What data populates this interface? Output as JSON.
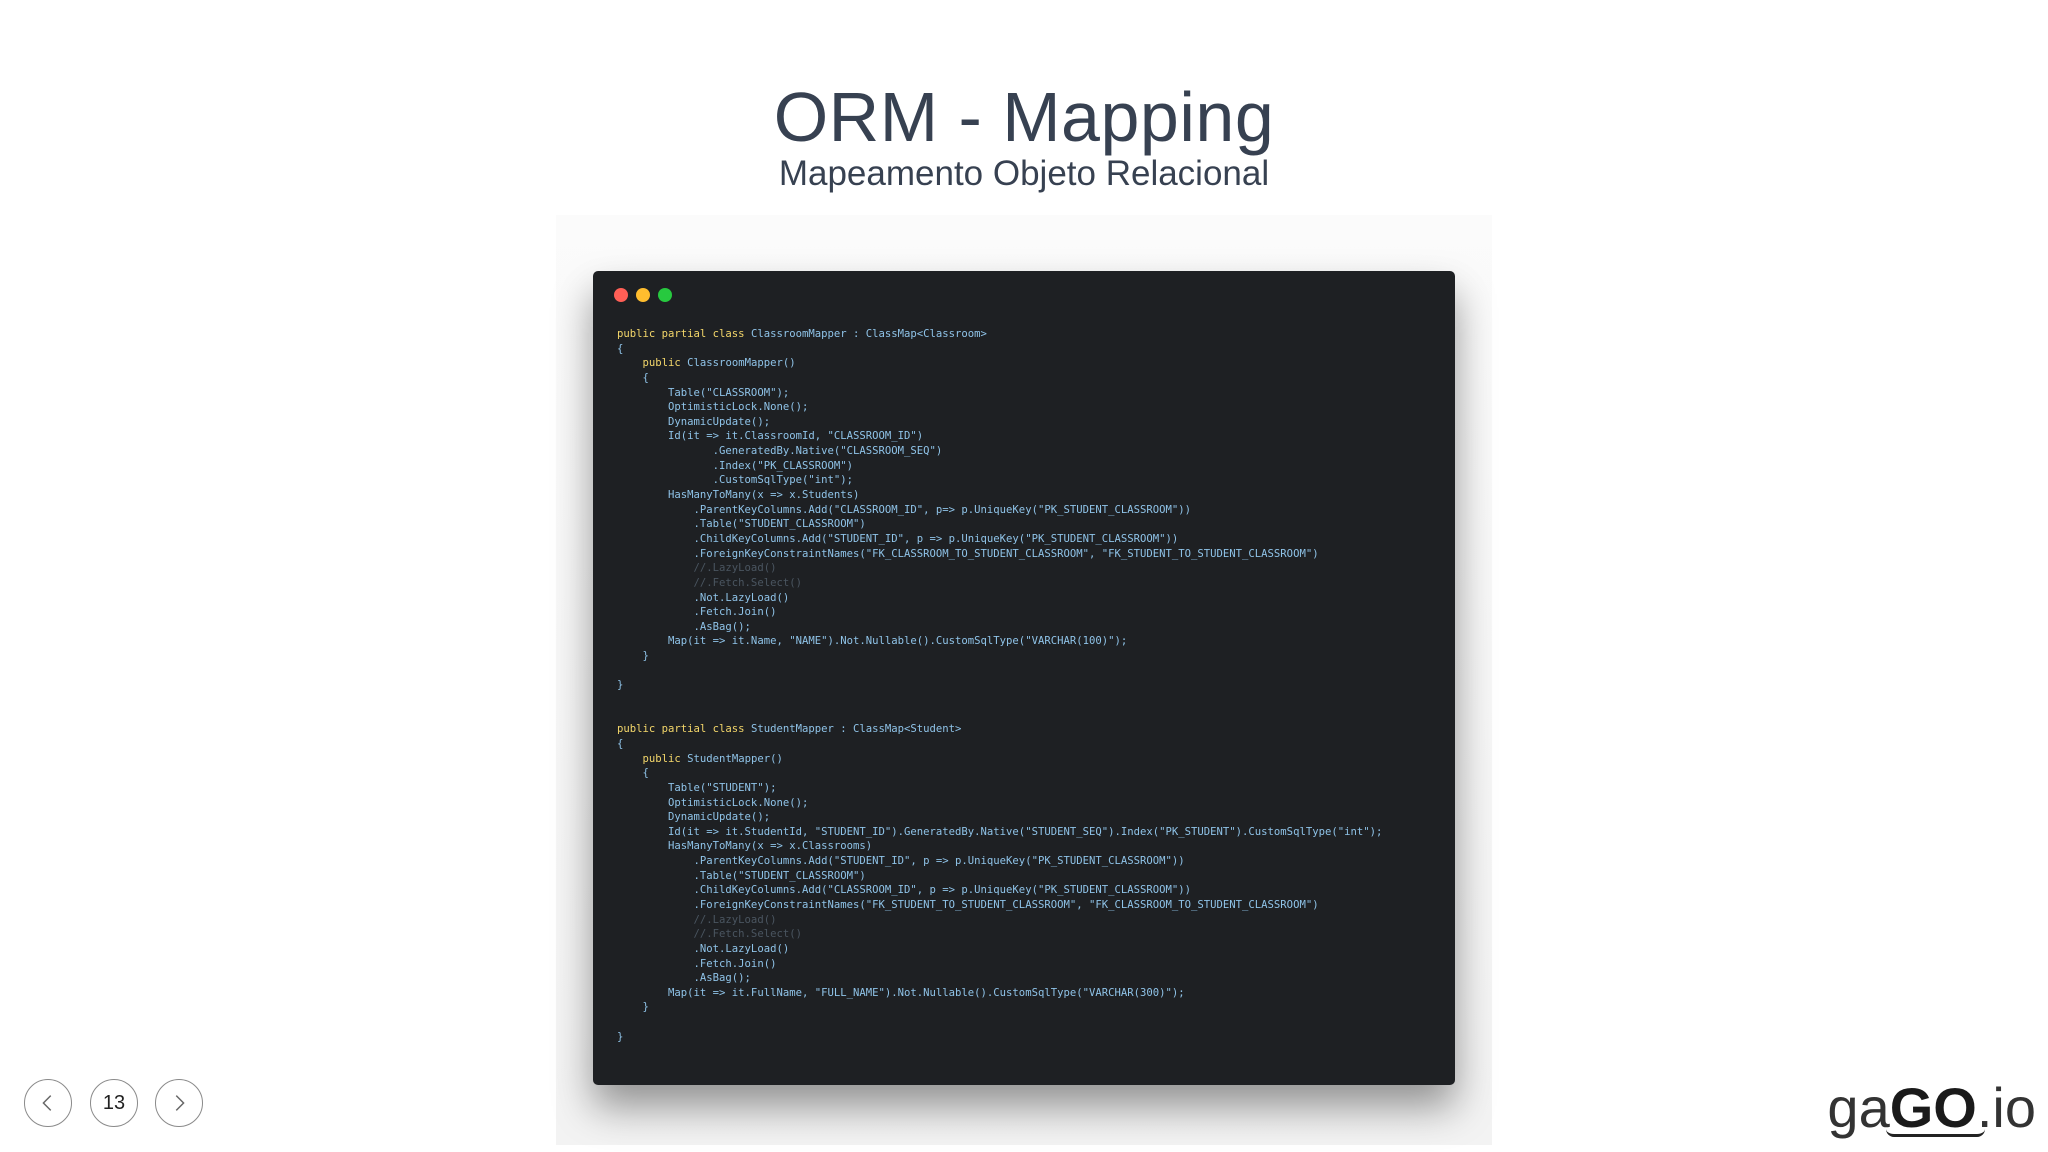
{
  "slide": {
    "title": "ORM - Mapping",
    "subtitle": "Mapeamento Objeto Relacional",
    "page_number": "13"
  },
  "window": {
    "dots": [
      {
        "name": "close",
        "color": "#ff5f56"
      },
      {
        "name": "minimize",
        "color": "#ffbd2e"
      },
      {
        "name": "maximize",
        "color": "#27c93f"
      }
    ]
  },
  "code": {
    "lines": [
      [
        {
          "t": "public partial class ",
          "c": "kw"
        },
        {
          "t": "ClassroomMapper : ClassMap<Classroom>"
        }
      ],
      [
        {
          "t": "{"
        }
      ],
      [
        {
          "t": "    "
        },
        {
          "t": "public ",
          "c": "kw"
        },
        {
          "t": "ClassroomMapper()"
        }
      ],
      [
        {
          "t": "    {"
        }
      ],
      [
        {
          "t": "        Table(\"CLASSROOM\");"
        }
      ],
      [
        {
          "t": "        OptimisticLock.None();"
        }
      ],
      [
        {
          "t": "        DynamicUpdate();"
        }
      ],
      [
        {
          "t": "        Id(it => it.ClassroomId, \"CLASSROOM_ID\")"
        }
      ],
      [
        {
          "t": "               .GeneratedBy.Native(\"CLASSROOM_SEQ\")"
        }
      ],
      [
        {
          "t": "               .Index(\"PK_CLASSROOM\")"
        }
      ],
      [
        {
          "t": "               .CustomSqlType(\"int\");"
        }
      ],
      [
        {
          "t": "        HasManyToMany(x => x.Students)"
        }
      ],
      [
        {
          "t": "            .ParentKeyColumns.Add(\"CLASSROOM_ID\", p=> p.UniqueKey(\"PK_STUDENT_CLASSROOM\"))"
        }
      ],
      [
        {
          "t": "            .Table(\"STUDENT_CLASSROOM\")"
        }
      ],
      [
        {
          "t": "            .ChildKeyColumns.Add(\"STUDENT_ID\", p => p.UniqueKey(\"PK_STUDENT_CLASSROOM\"))"
        }
      ],
      [
        {
          "t": "            .ForeignKeyConstraintNames(\"FK_CLASSROOM_TO_STUDENT_CLASSROOM\", \"FK_STUDENT_TO_STUDENT_CLASSROOM\")"
        }
      ],
      [
        {
          "t": "            //.LazyLoad()",
          "c": "cm"
        }
      ],
      [
        {
          "t": "            //.Fetch.Select()",
          "c": "cm"
        }
      ],
      [
        {
          "t": "            .Not.LazyLoad()"
        }
      ],
      [
        {
          "t": "            .Fetch.Join()"
        }
      ],
      [
        {
          "t": "            .AsBag();"
        }
      ],
      [
        {
          "t": "        Map(it => it.Name, \"NAME\").Not.Nullable().CustomSqlType(\"VARCHAR(100)\");"
        }
      ],
      [
        {
          "t": "    }"
        }
      ],
      [
        {
          "t": ""
        }
      ],
      [
        {
          "t": "}"
        }
      ],
      [
        {
          "t": ""
        }
      ],
      [
        {
          "t": ""
        }
      ],
      [
        {
          "t": "public partial class ",
          "c": "kw"
        },
        {
          "t": "StudentMapper : ClassMap<Student>"
        }
      ],
      [
        {
          "t": "{"
        }
      ],
      [
        {
          "t": "    "
        },
        {
          "t": "public ",
          "c": "kw"
        },
        {
          "t": "StudentMapper()"
        }
      ],
      [
        {
          "t": "    {"
        }
      ],
      [
        {
          "t": "        Table(\"STUDENT\");"
        }
      ],
      [
        {
          "t": "        OptimisticLock.None();"
        }
      ],
      [
        {
          "t": "        DynamicUpdate();"
        }
      ],
      [
        {
          "t": "        Id(it => it.StudentId, \"STUDENT_ID\").GeneratedBy.Native(\"STUDENT_SEQ\").Index(\"PK_STUDENT\").CustomSqlType(\"int\");"
        }
      ],
      [
        {
          "t": "        HasManyToMany(x => x.Classrooms)"
        }
      ],
      [
        {
          "t": "            .ParentKeyColumns.Add(\"STUDENT_ID\", p => p.UniqueKey(\"PK_STUDENT_CLASSROOM\"))"
        }
      ],
      [
        {
          "t": "            .Table(\"STUDENT_CLASSROOM\")"
        }
      ],
      [
        {
          "t": "            .ChildKeyColumns.Add(\"CLASSROOM_ID\", p => p.UniqueKey(\"PK_STUDENT_CLASSROOM\"))"
        }
      ],
      [
        {
          "t": "            .ForeignKeyConstraintNames(\"FK_STUDENT_TO_STUDENT_CLASSROOM\", \"FK_CLASSROOM_TO_STUDENT_CLASSROOM\")"
        }
      ],
      [
        {
          "t": "            //.LazyLoad()",
          "c": "cm"
        }
      ],
      [
        {
          "t": "            //.Fetch.Select()",
          "c": "cm"
        }
      ],
      [
        {
          "t": "            .Not.LazyLoad()"
        }
      ],
      [
        {
          "t": "            .Fetch.Join()"
        }
      ],
      [
        {
          "t": "            .AsBag();"
        }
      ],
      [
        {
          "t": "        Map(it => it.FullName, \"FULL_NAME\").Not.Nullable().CustomSqlType(\"VARCHAR(300)\");"
        }
      ],
      [
        {
          "t": "    }"
        }
      ],
      [
        {
          "t": ""
        }
      ],
      [
        {
          "t": "}"
        }
      ]
    ]
  },
  "navigation": {
    "prev_icon": "chevron-left-icon",
    "next_icon": "chevron-right-icon"
  },
  "logo": {
    "prefix": "ga",
    "highlight": "GO",
    "suffix": ".io"
  }
}
